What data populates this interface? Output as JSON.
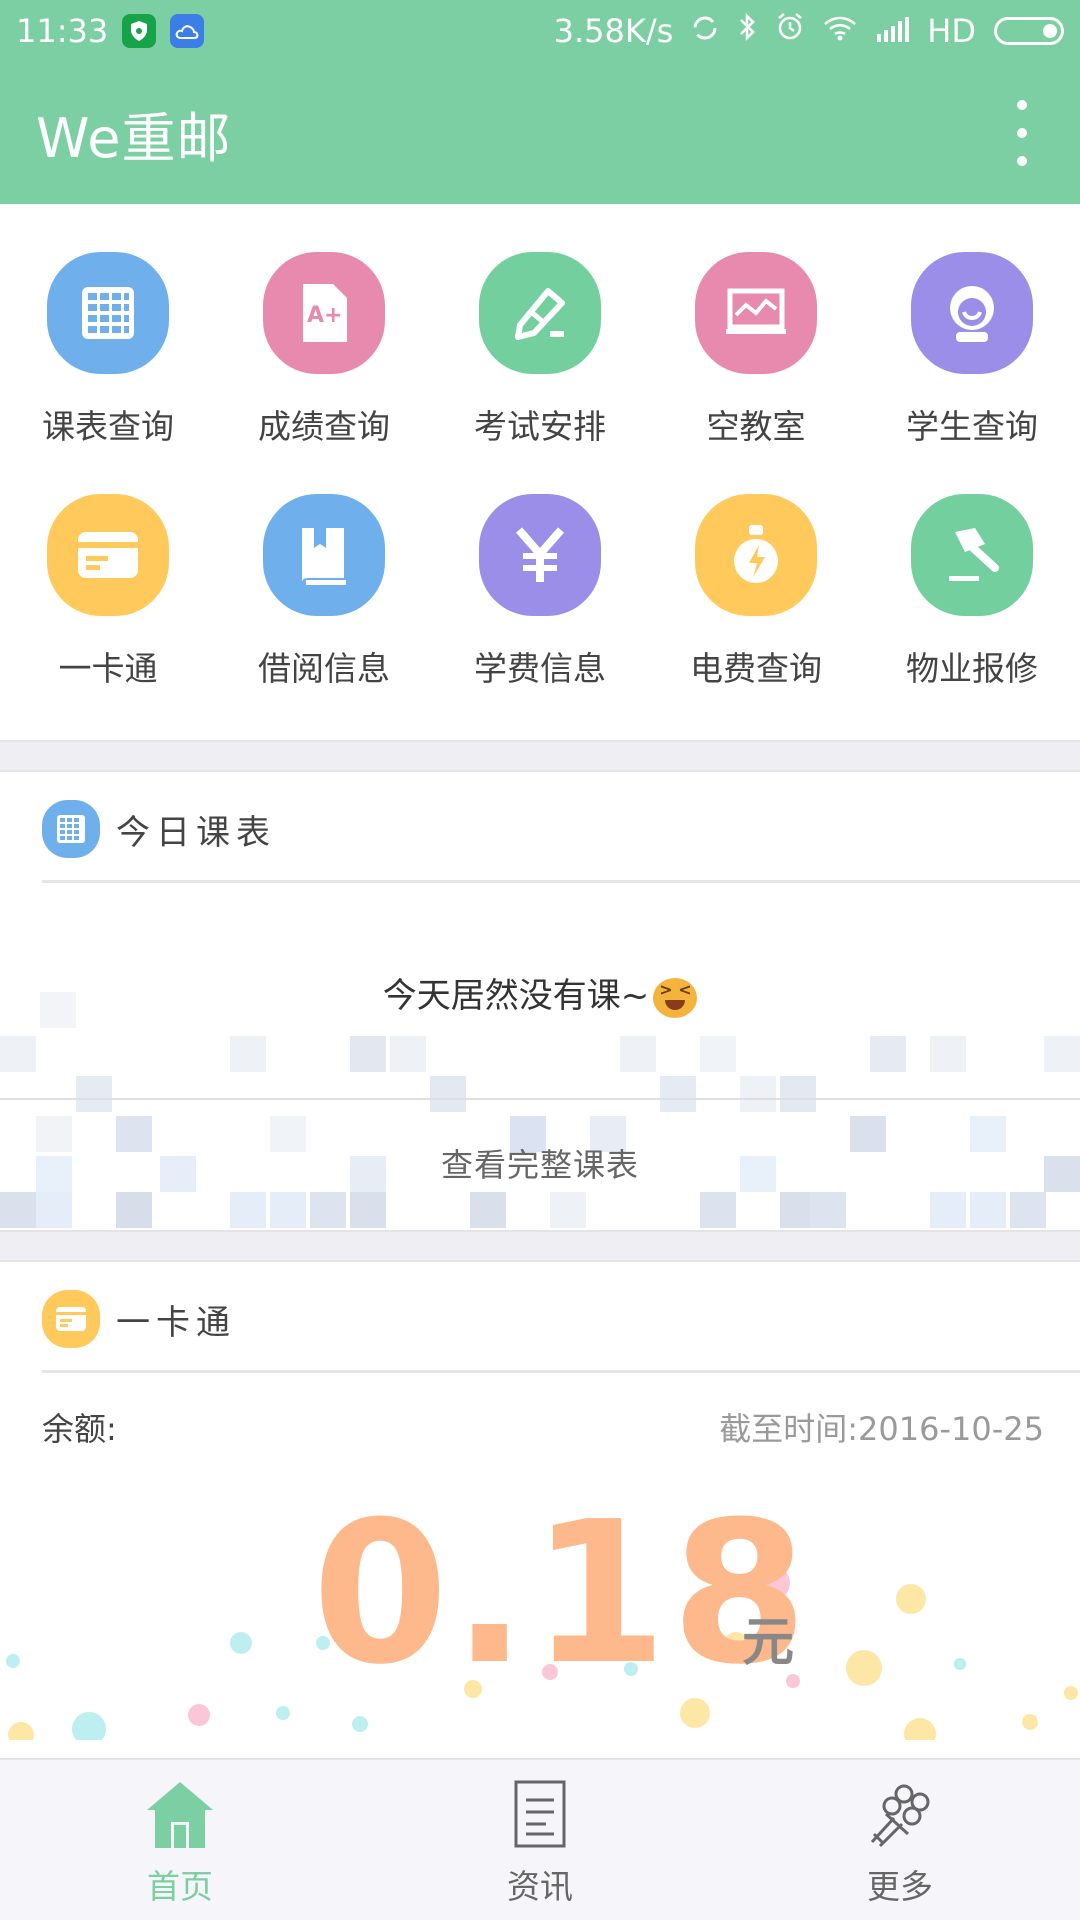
{
  "status_bar": {
    "time": "11:33",
    "speed": "3.58K/s",
    "network": "HD"
  },
  "app_bar": {
    "title": "We重邮",
    "menu_icon": "more-vert-icon"
  },
  "grid": [
    {
      "label": "课表查询",
      "icon": "calendar-grid-icon",
      "color": "#6fb0ec"
    },
    {
      "label": "成绩查询",
      "icon": "grade-document-icon",
      "color": "#e88aae"
    },
    {
      "label": "考试安排",
      "icon": "pencil-icon",
      "color": "#73cf9e"
    },
    {
      "label": "空教室",
      "icon": "blackboard-icon",
      "color": "#e88aae"
    },
    {
      "label": "学生查询",
      "icon": "student-avatar-icon",
      "color": "#9b8ee8"
    },
    {
      "label": "一卡通",
      "icon": "card-icon",
      "color": "#ffc95c"
    },
    {
      "label": "借阅信息",
      "icon": "book-icon",
      "color": "#6fb0ec"
    },
    {
      "label": "学费信息",
      "icon": "yen-icon",
      "color": "#9b8ee8"
    },
    {
      "label": "电费查询",
      "icon": "electric-bulb-icon",
      "color": "#ffc95c"
    },
    {
      "label": "物业报修",
      "icon": "hammer-icon",
      "color": "#73cf9e"
    }
  ],
  "schedule": {
    "title": "今日课表",
    "empty_message": "今天居然没有课~",
    "full_link": "查看完整课表"
  },
  "card": {
    "title": "一卡通",
    "balance_label": "余额:",
    "as_of": "截至时间:2016-10-25",
    "balance": "0.18",
    "unit": "元"
  },
  "bottom_nav": [
    {
      "label": "首页",
      "icon": "home-icon",
      "active": true
    },
    {
      "label": "资讯",
      "icon": "news-icon",
      "active": false
    },
    {
      "label": "更多",
      "icon": "flowers-icon",
      "active": false
    }
  ],
  "colors": {
    "primary": "#7ccfa3",
    "balance": "#fdb98b"
  }
}
